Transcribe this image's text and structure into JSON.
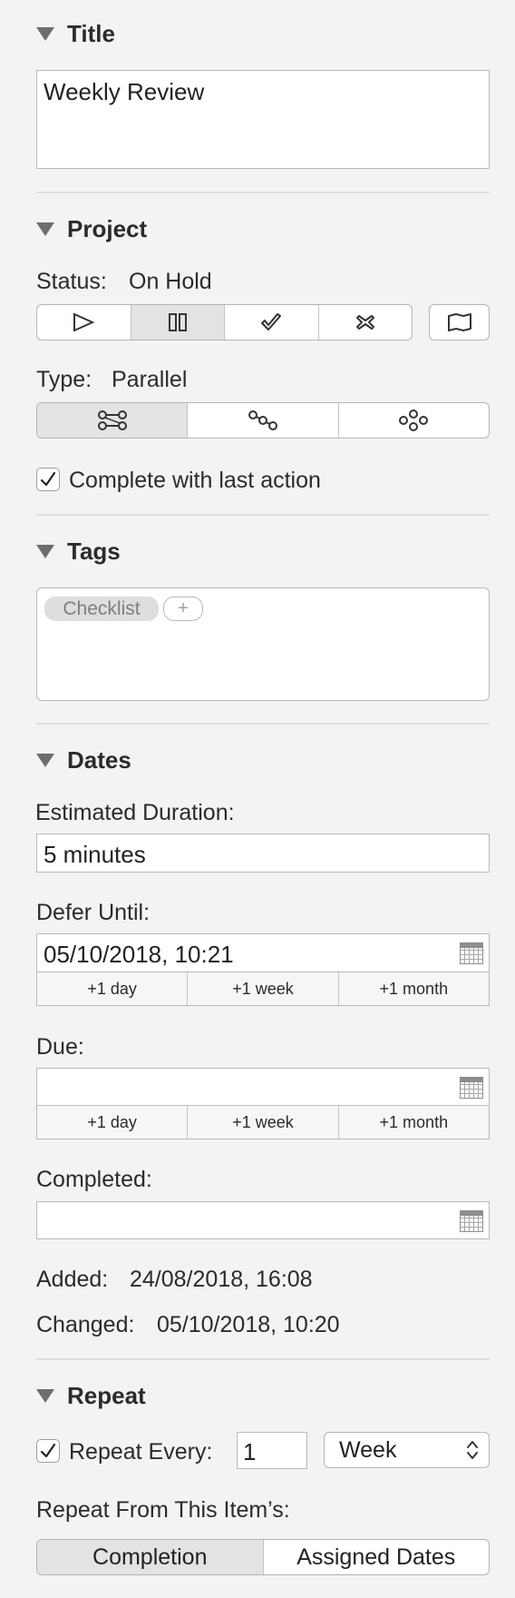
{
  "title_section": {
    "heading": "Title",
    "value": "Weekly Review"
  },
  "project_section": {
    "heading": "Project",
    "status_label": "Status:",
    "status_value": "On Hold",
    "status_icons": [
      "play-icon",
      "pause-icon",
      "checkmark-icon",
      "drop-icon",
      "folder-icon"
    ],
    "type_label": "Type:",
    "type_value": "Parallel",
    "type_icons": [
      "parallel-icon",
      "sequential-icon",
      "single-actions-icon"
    ],
    "complete_with_last_action_label": "Complete with last action",
    "complete_with_last_action_checked": true
  },
  "tags_section": {
    "heading": "Tags",
    "tags": [
      "Checklist"
    ],
    "add_label": "+"
  },
  "dates_section": {
    "heading": "Dates",
    "estimated_duration_label": "Estimated Duration:",
    "estimated_duration_value": "5 minutes",
    "defer_label": "Defer Until:",
    "defer_value": "05/10/2018, 10:21",
    "due_label": "Due:",
    "due_value": "",
    "completed_label": "Completed:",
    "completed_value": "",
    "quick_buttons": [
      "+1 day",
      "+1 week",
      "+1 month"
    ],
    "added_label": "Added:",
    "added_value": "24/08/2018, 16:08",
    "changed_label": "Changed:",
    "changed_value": "05/10/2018, 10:20"
  },
  "repeat_section": {
    "heading": "Repeat",
    "repeat_every_label": "Repeat Every:",
    "repeat_every_checked": true,
    "repeat_interval": "1",
    "repeat_unit": "Week",
    "repeat_from_label": "Repeat From This Item’s:",
    "repeat_from_options": [
      "Completion",
      "Assigned Dates"
    ],
    "repeat_from_selected": "Completion"
  },
  "colors": {
    "background": "#f3f3f3",
    "segment_active": "#e3e3e3",
    "tag_chip": "#dedede"
  }
}
